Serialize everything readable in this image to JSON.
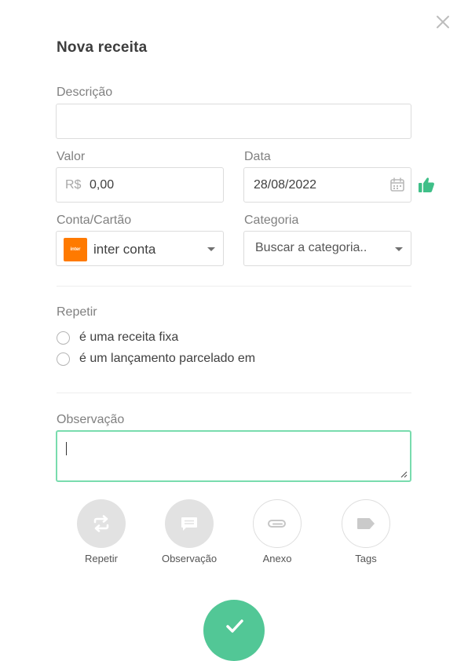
{
  "dialog": {
    "title": "Nova receita",
    "close_icon": "close-icon"
  },
  "descricao": {
    "label": "Descrição",
    "value": ""
  },
  "valor": {
    "label": "Valor",
    "currency": "R$",
    "value": "0,00"
  },
  "data": {
    "label": "Data",
    "value": "28/08/2022",
    "icon": "calendar-icon",
    "status_icon": "thumbs-up-icon"
  },
  "conta": {
    "label": "Conta/Cartão",
    "logo_text": "inter",
    "value": "inter conta",
    "logo_color": "#ff7a00"
  },
  "categoria": {
    "label": "Categoria",
    "placeholder": "Buscar a categoria.."
  },
  "repetir": {
    "label": "Repetir",
    "options": [
      {
        "label": "é uma receita fixa"
      },
      {
        "label": "é um lançamento parcelado em"
      }
    ]
  },
  "observacao": {
    "label": "Observação",
    "value": "",
    "focus_color": "#5fd19e"
  },
  "actions": [
    {
      "label": "Repetir",
      "icon": "repeat-icon"
    },
    {
      "label": "Observação",
      "icon": "comment-icon"
    },
    {
      "label": "Anexo",
      "icon": "paperclip-icon"
    },
    {
      "label": "Tags",
      "icon": "tag-icon"
    }
  ],
  "submit": {
    "icon": "check-icon",
    "color": "#52c796"
  },
  "colors": {
    "accent": "#52c796",
    "thumbs": "#3fbf88"
  }
}
